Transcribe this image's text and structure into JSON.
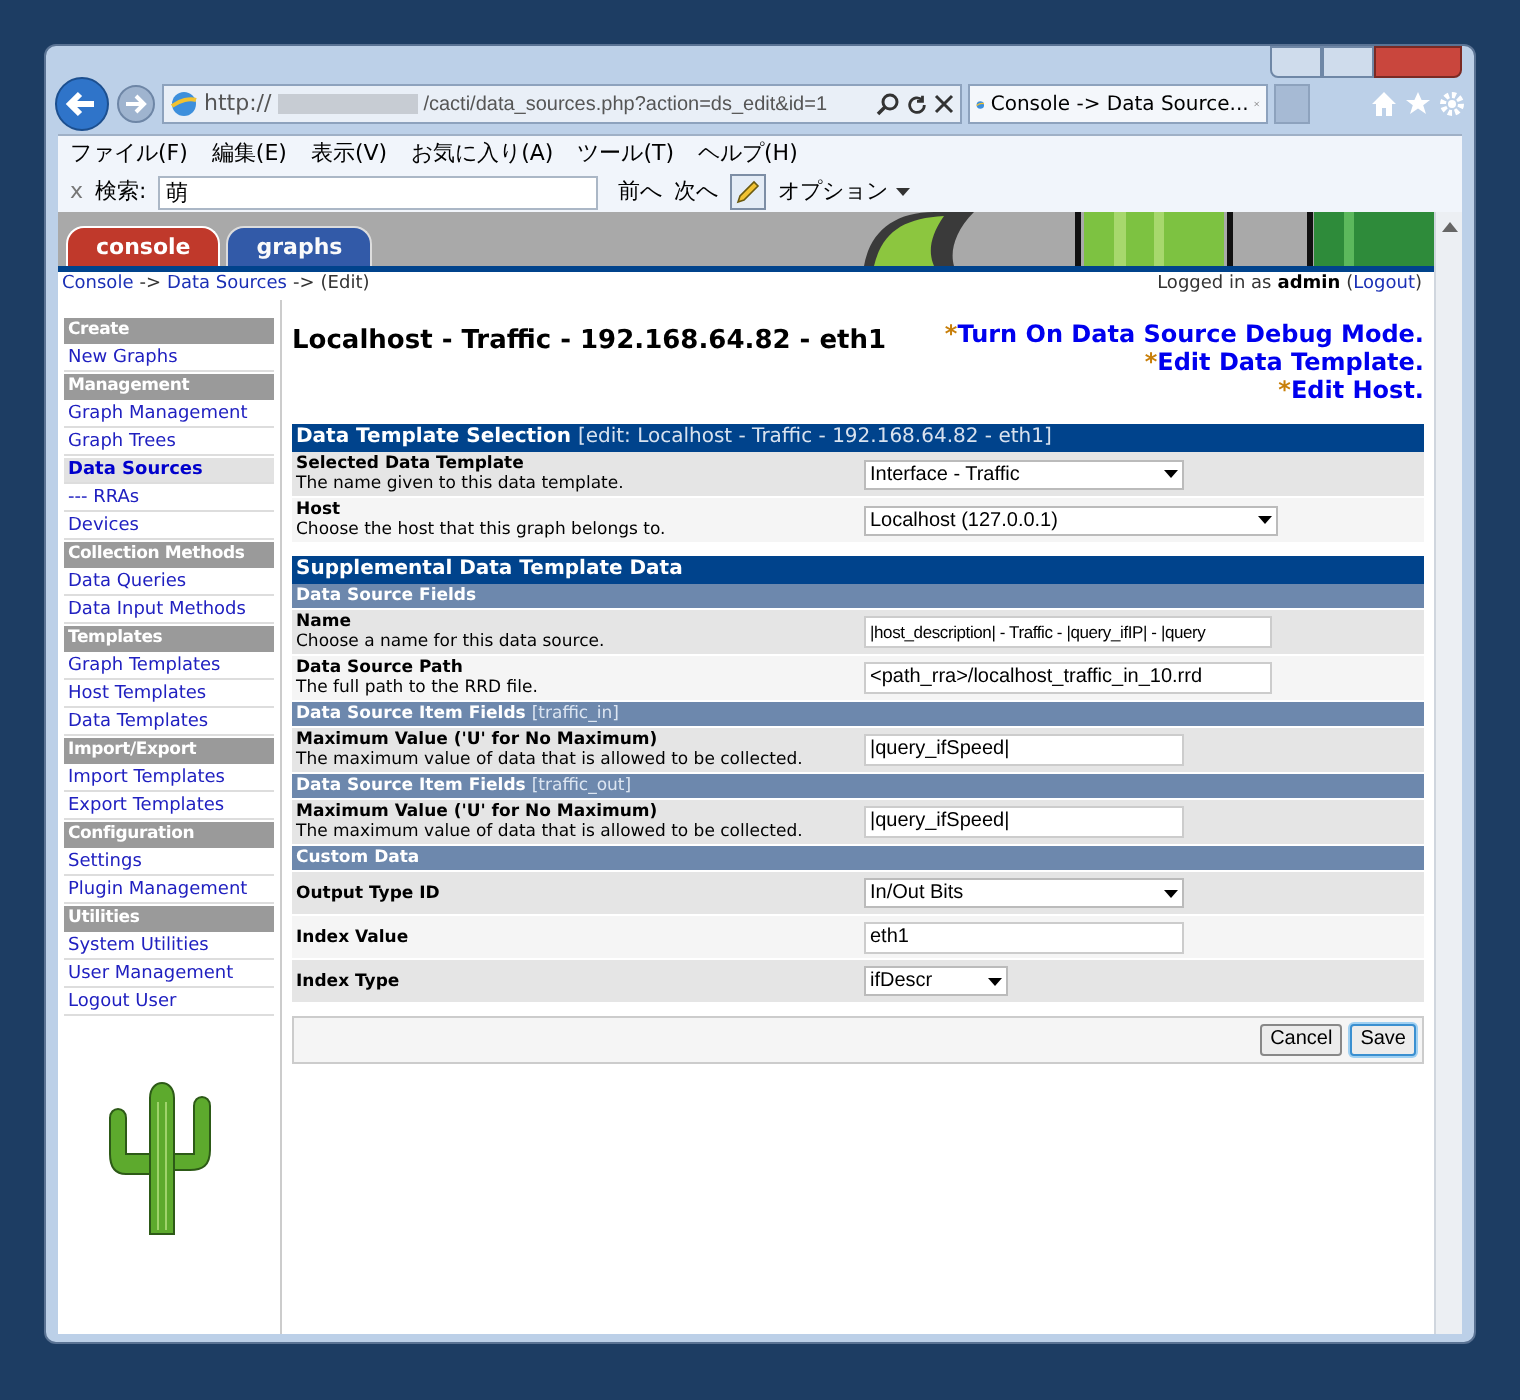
{
  "browser": {
    "url_scheme": "http://",
    "url_path": "/cacti/data_sources.php?action=ds_edit&id=1",
    "tab_title": "Console -> Data Source...",
    "menu": [
      "ファイル(F)",
      "編集(E)",
      "表示(V)",
      "お気に入り(A)",
      "ツール(T)",
      "ヘルプ(H)"
    ],
    "find": {
      "close": "x",
      "label": "検索:",
      "value": "萌",
      "prev": "前へ",
      "next": "次へ",
      "options": "オプション"
    }
  },
  "tabs": [
    {
      "label": "console",
      "selected": true,
      "color": "#c0392b"
    },
    {
      "label": "graphs",
      "selected": false,
      "color": "#2c56a8"
    }
  ],
  "breadcrumb": {
    "items": [
      "Console",
      "Data Sources",
      "(Edit)"
    ],
    "separator": "->",
    "login_prefix": "Logged in as",
    "user": "admin",
    "logout_open": "(",
    "logout": "Logout",
    "logout_close": ")"
  },
  "sidebar": [
    {
      "kind": "header",
      "label": "Create"
    },
    {
      "kind": "link",
      "label": "New Graphs",
      "selected": false
    },
    {
      "kind": "header",
      "label": "Management"
    },
    {
      "kind": "link",
      "label": "Graph Management",
      "selected": false
    },
    {
      "kind": "link",
      "label": "Graph Trees",
      "selected": false
    },
    {
      "kind": "link",
      "label": "Data Sources",
      "selected": true
    },
    {
      "kind": "link",
      "label": "--- RRAs",
      "selected": false
    },
    {
      "kind": "link",
      "label": "Devices",
      "selected": false
    },
    {
      "kind": "header",
      "label": "Collection Methods"
    },
    {
      "kind": "link",
      "label": "Data Queries",
      "selected": false
    },
    {
      "kind": "link",
      "label": "Data Input Methods",
      "selected": false
    },
    {
      "kind": "header",
      "label": "Templates"
    },
    {
      "kind": "link",
      "label": "Graph Templates",
      "selected": false
    },
    {
      "kind": "link",
      "label": "Host Templates",
      "selected": false
    },
    {
      "kind": "link",
      "label": "Data Templates",
      "selected": false
    },
    {
      "kind": "header",
      "label": "Import/Export"
    },
    {
      "kind": "link",
      "label": "Import Templates",
      "selected": false
    },
    {
      "kind": "link",
      "label": "Export Templates",
      "selected": false
    },
    {
      "kind": "header",
      "label": "Configuration"
    },
    {
      "kind": "link",
      "label": "Settings",
      "selected": false
    },
    {
      "kind": "link",
      "label": "Plugin Management",
      "selected": false
    },
    {
      "kind": "header",
      "label": "Utilities"
    },
    {
      "kind": "link",
      "label": "System Utilities",
      "selected": false
    },
    {
      "kind": "link",
      "label": "User Management",
      "selected": false
    },
    {
      "kind": "link",
      "label": "Logout User",
      "selected": false
    }
  ],
  "main": {
    "title": "Localhost - Traffic - 192.168.64.82 - eth1",
    "actions": [
      {
        "mark": "*",
        "label": "Turn On Data Source Debug Mode."
      },
      {
        "mark": "*",
        "label": "Edit Data Template."
      },
      {
        "mark": "*",
        "label": "Edit Host."
      }
    ],
    "sections": [
      {
        "title": "Data Template Selection",
        "note": "[edit: Localhost - Traffic - 192.168.64.82 - eth1]",
        "groups": [
          {
            "rows": [
              {
                "label": "Selected Data Template",
                "description": "The name given to this data template.",
                "field": {
                  "kind": "select",
                  "value": "Interface - Traffic"
                }
              },
              {
                "label": "Host",
                "description": "Choose the host that this graph belongs to.",
                "field": {
                  "kind": "select",
                  "value": "Localhost (127.0.0.1)"
                }
              }
            ]
          }
        ]
      },
      {
        "title": "Supplemental Data Template Data",
        "groups": [
          {
            "title": "Data Source Fields",
            "rows": [
              {
                "label": "Name",
                "description": "Choose a name for this data source.",
                "field": {
                  "kind": "text",
                  "value": "|host_description| - Traffic - |query_ifIP| - |query"
                }
              },
              {
                "label": "Data Source Path",
                "description": "The full path to the RRD file.",
                "field": {
                  "kind": "text",
                  "value": "<path_rra>/localhost_traffic_in_10.rrd"
                }
              }
            ]
          },
          {
            "title": "Data Source Item Fields",
            "note": "[traffic_in]",
            "rows": [
              {
                "label": "Maximum Value ('U' for No Maximum)",
                "description": "The maximum value of data that is allowed to be collected.",
                "field": {
                  "kind": "text",
                  "value": "|query_ifSpeed|"
                }
              }
            ]
          },
          {
            "title": "Data Source Item Fields",
            "note": "[traffic_out]",
            "rows": [
              {
                "label": "Maximum Value ('U' for No Maximum)",
                "description": "The maximum value of data that is allowed to be collected.",
                "field": {
                  "kind": "text",
                  "value": "|query_ifSpeed|"
                }
              }
            ]
          },
          {
            "title": "Custom Data",
            "rows": [
              {
                "label": "Output Type ID",
                "field": {
                  "kind": "select",
                  "value": "In/Out Bits"
                }
              },
              {
                "label": "Index Value",
                "field": {
                  "kind": "text",
                  "value": "eth1"
                }
              },
              {
                "label": "Index Type",
                "field": {
                  "kind": "select",
                  "value": "ifDescr"
                }
              }
            ]
          }
        ]
      }
    ],
    "buttons": [
      {
        "kind": "cancel",
        "label": "Cancel"
      },
      {
        "kind": "save",
        "label": "Save"
      }
    ]
  }
}
